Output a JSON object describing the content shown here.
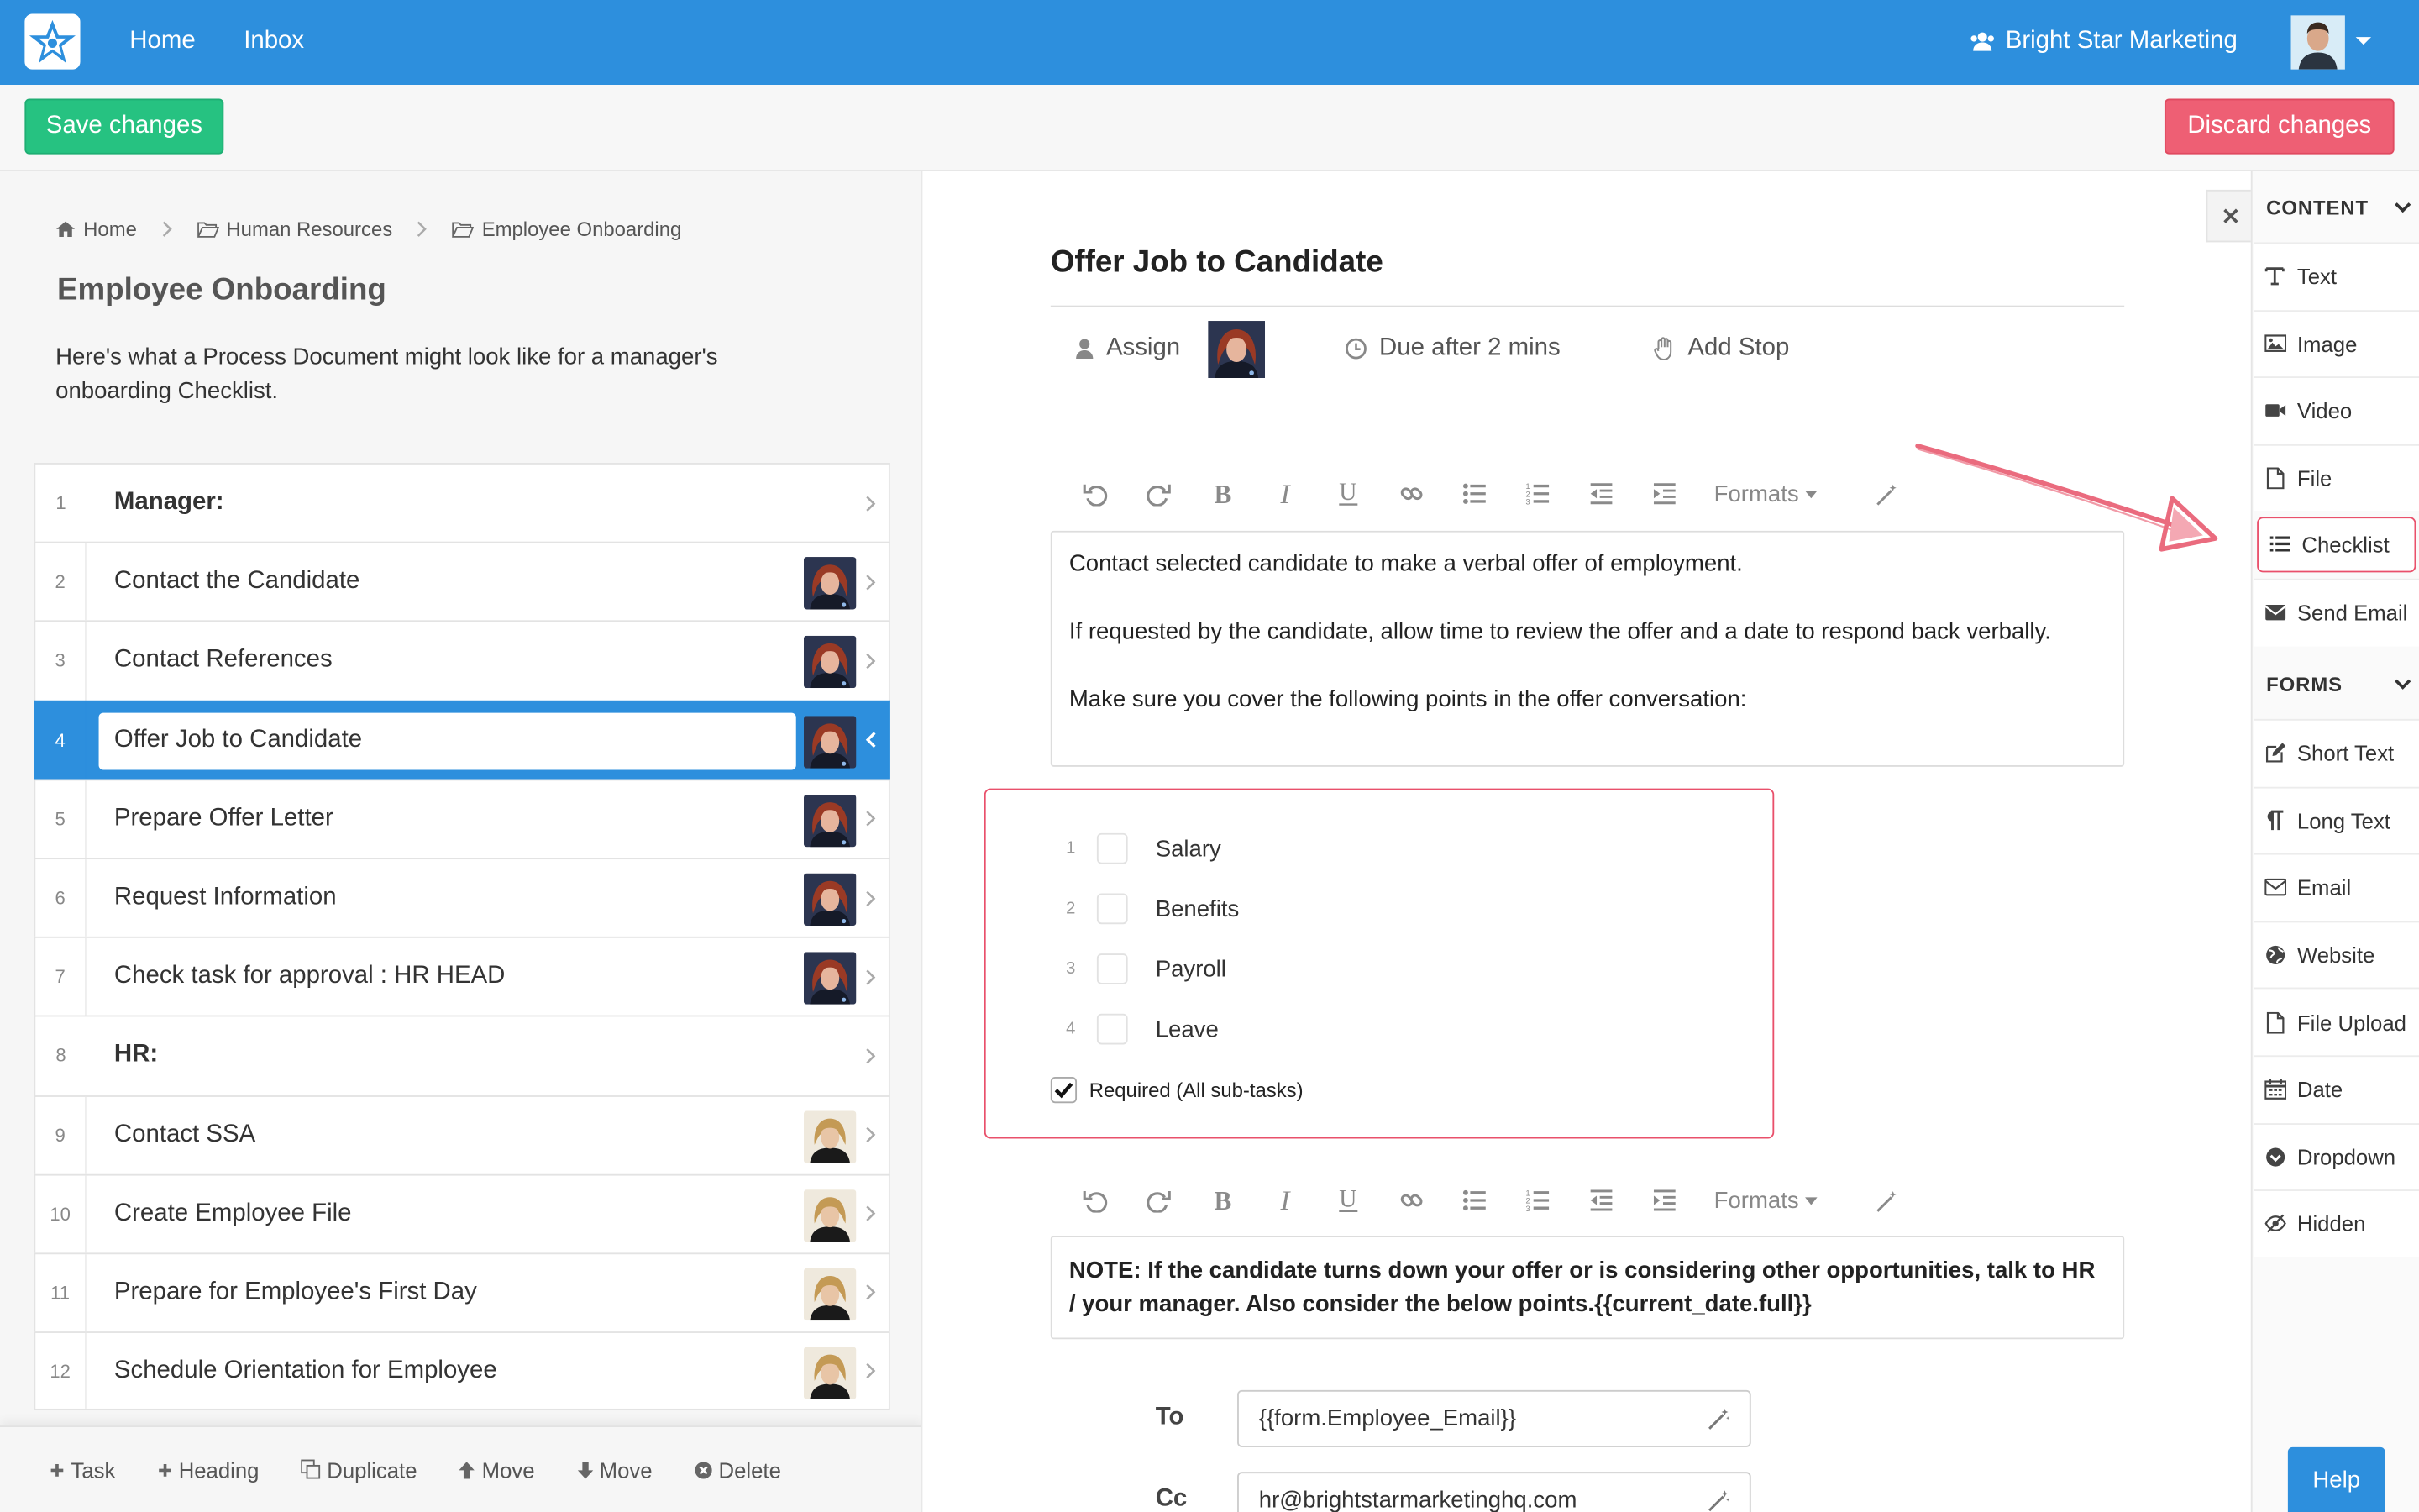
{
  "nav": {
    "links": [
      "Home",
      "Inbox"
    ],
    "org_name": "Bright Star Marketing",
    "brand_color": "#2d8fdd"
  },
  "actions": {
    "save_label": "Save changes",
    "discard_label": "Discard changes",
    "save_color": "#26c281",
    "discard_color": "#ee5f74"
  },
  "breadcrumb": [
    "Home",
    "Human Resources",
    "Employee Onboarding"
  ],
  "document": {
    "title": "Employee Onboarding",
    "description": "Here's what a Process Document might look like for a manager's onboarding Checklist."
  },
  "tasks": [
    {
      "num": "1",
      "label": "Manager:",
      "heading": true
    },
    {
      "num": "2",
      "label": "Contact the Candidate",
      "assignee": "red-hair"
    },
    {
      "num": "3",
      "label": "Contact References",
      "assignee": "red-hair"
    },
    {
      "num": "4",
      "label": "Offer Job to Candidate",
      "assignee": "red-hair",
      "active": true
    },
    {
      "num": "5",
      "label": "Prepare Offer Letter",
      "assignee": "red-hair"
    },
    {
      "num": "6",
      "label": "Request Information",
      "assignee": "red-hair"
    },
    {
      "num": "7",
      "label": "Check task for approval : HR HEAD",
      "assignee": "red-hair"
    },
    {
      "num": "8",
      "label": "HR:",
      "heading": true
    },
    {
      "num": "9",
      "label": "Contact SSA",
      "assignee": "blonde"
    },
    {
      "num": "10",
      "label": "Create Employee File",
      "assignee": "blonde"
    },
    {
      "num": "11",
      "label": "Prepare for Employee's First Day",
      "assignee": "blonde"
    },
    {
      "num": "12",
      "label": "Schedule Orientation for Employee",
      "assignee": "blonde"
    }
  ],
  "bottom_actions": [
    "Task",
    "Heading",
    "Duplicate",
    "Move",
    "Move",
    "Delete"
  ],
  "step": {
    "title": "Offer Job to Candidate",
    "assign_label": "Assign",
    "due_label": "Due after 2 mins",
    "stop_label": "Add Stop",
    "formats_label": "Formats",
    "text_block_1": [
      "Contact selected candidate to make a verbal offer of employment.",
      "If requested by the candidate, allow time to review the offer and a date to respond back verbally.",
      "Make sure you cover the following points in the offer conversation:"
    ],
    "checklist": [
      {
        "num": "1",
        "label": "Salary"
      },
      {
        "num": "2",
        "label": "Benefits"
      },
      {
        "num": "3",
        "label": "Payroll"
      },
      {
        "num": "4",
        "label": "Leave"
      }
    ],
    "required_label": "Required (All sub-tasks)",
    "required_checked": true,
    "text_block_2": "NOTE: If the candidate turns down your offer or is considering other opportunities, talk to HR / your manager. Also consider the below points.{{current_date.full}}",
    "email": {
      "to_label": "To",
      "to_value": "{{form.Employee_Email}}",
      "cc_label": "Cc",
      "cc_value": "hr@brightstarmarketinghq.com"
    }
  },
  "sidebar": {
    "content_heading": "CONTENT",
    "content_items": [
      {
        "icon": "text-icon",
        "label": "Text"
      },
      {
        "icon": "image-icon",
        "label": "Image"
      },
      {
        "icon": "video-icon",
        "label": "Video"
      },
      {
        "icon": "file-icon",
        "label": "File"
      },
      {
        "icon": "checklist-icon",
        "label": "Checklist",
        "highlighted": true
      },
      {
        "icon": "envelope-icon",
        "label": "Send Email"
      }
    ],
    "forms_heading": "FORMS",
    "forms_items": [
      {
        "icon": "edit-icon",
        "label": "Short Text"
      },
      {
        "icon": "paragraph-icon",
        "label": "Long Text"
      },
      {
        "icon": "envelope-outline-icon",
        "label": "Email"
      },
      {
        "icon": "globe-icon",
        "label": "Website"
      },
      {
        "icon": "file-icon",
        "label": "File Upload"
      },
      {
        "icon": "calendar-icon",
        "label": "Date"
      },
      {
        "icon": "dropdown-icon",
        "label": "Dropdown"
      },
      {
        "icon": "eye-slash-icon",
        "label": "Hidden"
      }
    ],
    "highlight_color": "#e9506b"
  },
  "help_label": "Help"
}
